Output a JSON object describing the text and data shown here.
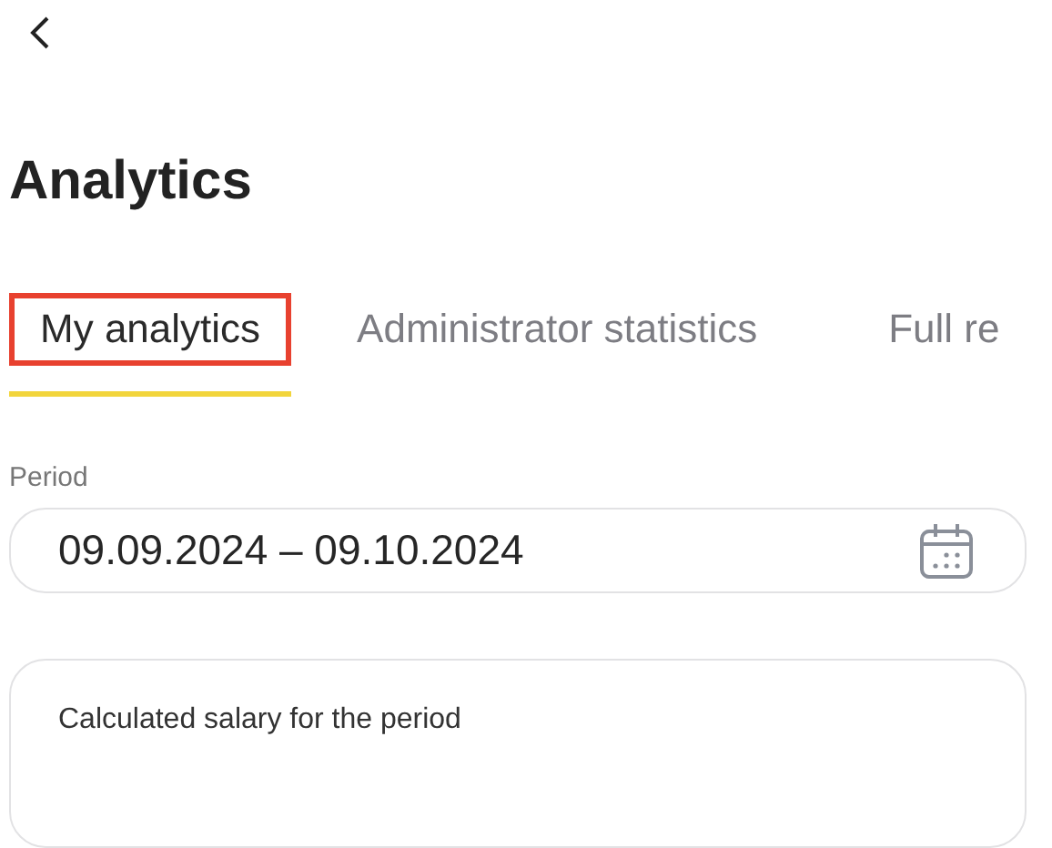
{
  "header": {
    "title": "Analytics"
  },
  "tabs": [
    {
      "label": "My analytics",
      "selected": true,
      "highlighted": true
    },
    {
      "label": "Administrator statistics",
      "selected": false,
      "highlighted": false
    },
    {
      "label": "Full re",
      "selected": false,
      "highlighted": false
    }
  ],
  "period": {
    "label": "Period",
    "value": "09.09.2024 – 09.10.2024"
  },
  "salary_card": {
    "title": "Calculated salary for the period"
  }
}
